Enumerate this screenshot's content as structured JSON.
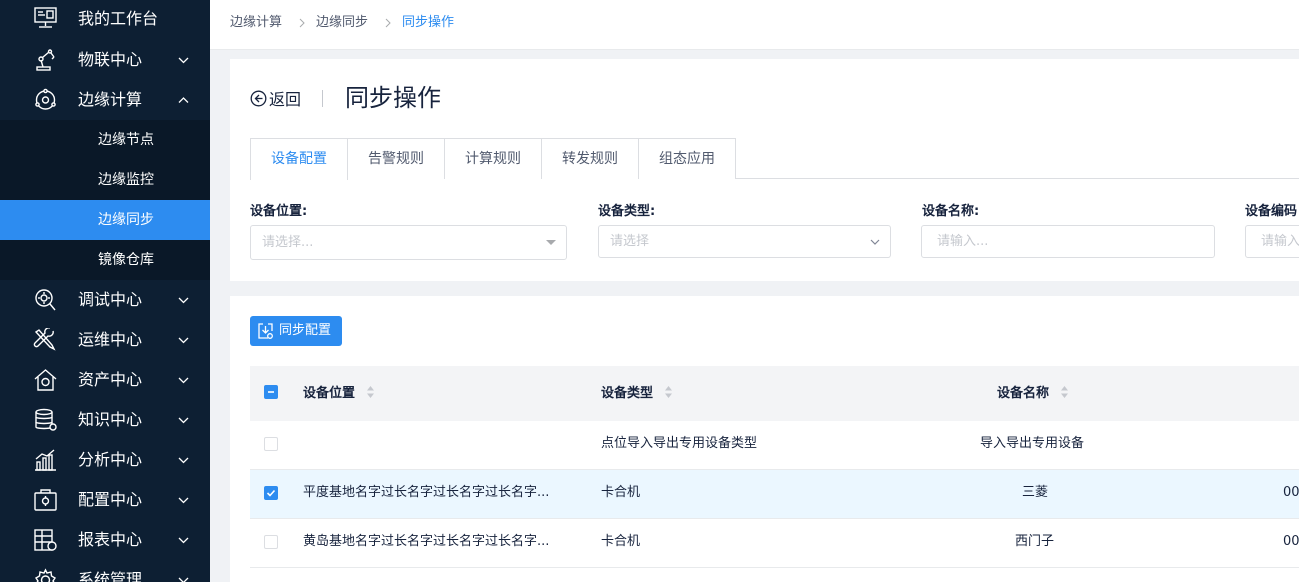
{
  "sidebar": {
    "items": [
      {
        "label": "我的工作台",
        "icon": "monitor-icon"
      },
      {
        "label": "物联中心",
        "icon": "robot-arm-icon"
      },
      {
        "label": "边缘计算",
        "icon": "edge-compute-icon"
      },
      {
        "label": "调试中心",
        "icon": "search-debug-icon"
      },
      {
        "label": "运维中心",
        "icon": "tools-icon"
      },
      {
        "label": "资产中心",
        "icon": "asset-house-icon"
      },
      {
        "label": "知识中心",
        "icon": "database-icon"
      },
      {
        "label": "分析中心",
        "icon": "bar-chart-icon"
      },
      {
        "label": "配置中心",
        "icon": "config-box-icon"
      },
      {
        "label": "报表中心",
        "icon": "report-icon"
      },
      {
        "label": "系统管理",
        "icon": "gear-icon"
      }
    ],
    "sub_items": [
      "边缘节点",
      "边缘监控",
      "边缘同步",
      "镜像仓库"
    ],
    "active_sub": "边缘同步"
  },
  "breadcrumb": [
    "边缘计算",
    "边缘同步",
    "同步操作"
  ],
  "header": {
    "back_label": "返回",
    "title": "同步操作"
  },
  "tabs": [
    "设备配置",
    "告警规则",
    "计算规则",
    "转发规则",
    "组态应用"
  ],
  "active_tab": "设备配置",
  "filters": [
    {
      "label": "设备位置:",
      "placeholder": "请选择..."
    },
    {
      "label": "设备类型:",
      "placeholder": "请选择"
    },
    {
      "label": "设备名称:",
      "placeholder": "请输入..."
    },
    {
      "label": "设备编码",
      "placeholder": "请输入"
    }
  ],
  "toolbar": {
    "sync_label": "同步配置"
  },
  "table": {
    "columns": [
      "设备位置",
      "设备类型",
      "设备名称"
    ],
    "rows": [
      {
        "location": "",
        "type": "点位导入导出专用设备类型",
        "name": "导入导出专用设备",
        "code": "",
        "checked": false
      },
      {
        "location": "平度基地名字过长名字过长名字过长名字...",
        "type": "卡合机",
        "name": "三菱",
        "code": "00",
        "checked": true
      },
      {
        "location": "黄岛基地名字过长名字过长名字过长名字...",
        "type": "卡合机",
        "name": "西门子",
        "code": "00",
        "checked": false
      }
    ]
  },
  "colors": {
    "primary": "#2d8cf0",
    "sidebar_bg": "#0d1f33",
    "selected_row": "#ebf7ff"
  }
}
